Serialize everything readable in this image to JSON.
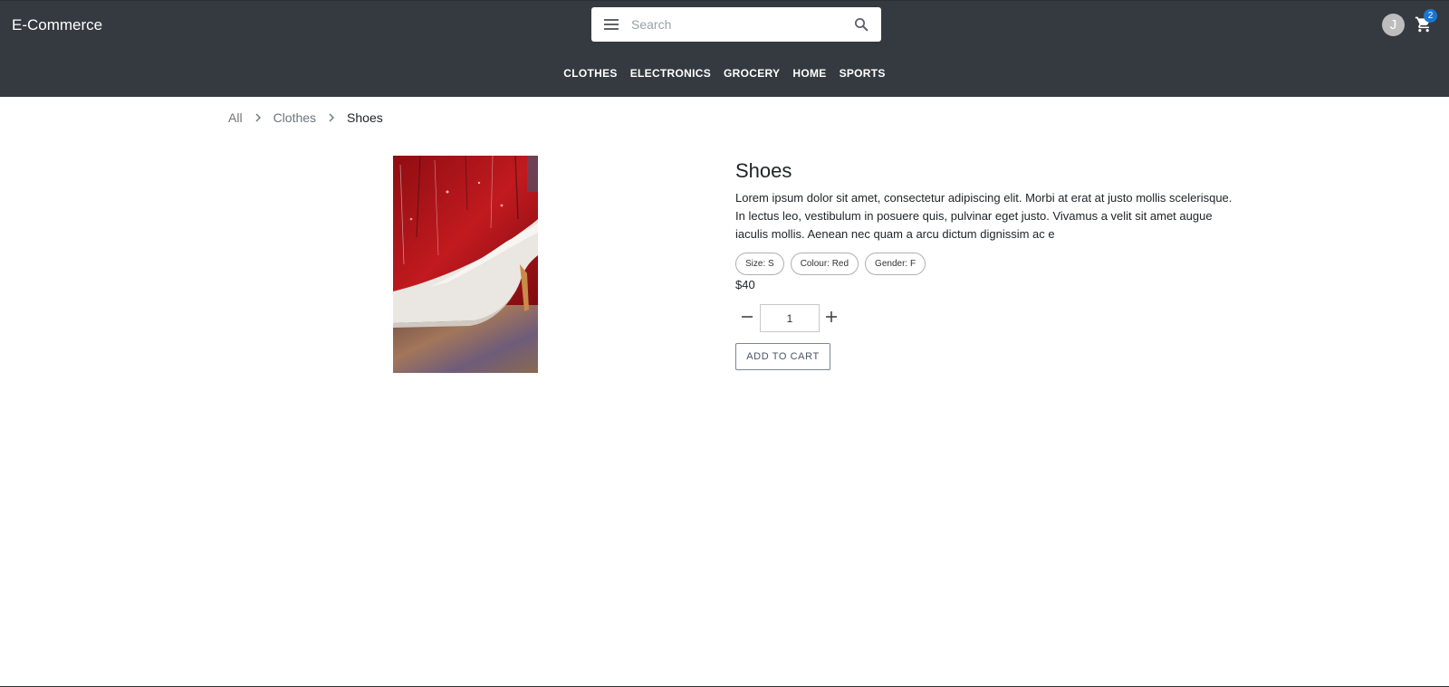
{
  "header": {
    "brand": "E-Commerce",
    "search_placeholder": "Search",
    "avatar_initial": "J",
    "cart_count": "2",
    "background": "#343a40"
  },
  "nav": {
    "items": [
      "CLOTHES",
      "ELECTRONICS",
      "GROCERY",
      "HOME",
      "SPORTS"
    ]
  },
  "breadcrumb": {
    "items": [
      "All",
      "Clothes"
    ],
    "current": "Shoes"
  },
  "product": {
    "title": "Shoes",
    "description": "Lorem ipsum dolor sit amet, consectetur adipiscing elit. Morbi at erat at justo mollis scelerisque. In lectus leo, vestibulum in posuere quis, pulvinar eget justo. Vivamus a velit sit amet augue iaculis mollis. Aenean nec quam a arcu dictum dignissim ac e",
    "attributes": [
      "Size: S",
      "Colour: Red",
      "Gender: F"
    ],
    "price": "$40",
    "quantity": "1",
    "add_to_cart_label": "ADD TO CART",
    "image_icon": "shoe-photo"
  },
  "icons": {
    "menu": "menu-icon",
    "search": "search-icon",
    "cart": "cart-icon",
    "chevron": "chevron-right-icon",
    "minus": "minus-icon",
    "plus": "plus-icon"
  },
  "colors": {
    "header_bg": "#343a40",
    "badge": "#1976d2",
    "avatar": "#bdbdbd"
  }
}
